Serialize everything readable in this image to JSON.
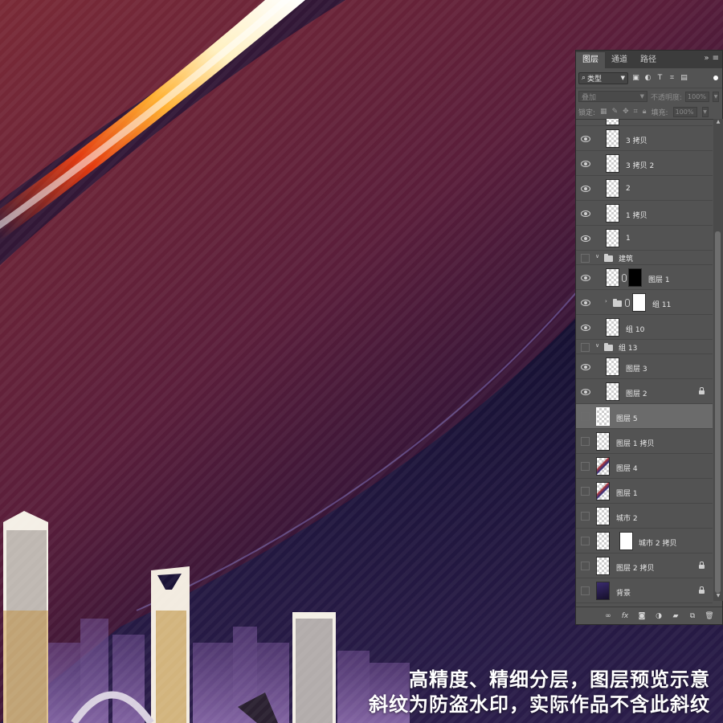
{
  "background": {
    "base_colors": [
      "#7a2a36",
      "#2a1236",
      "#0b0a26",
      "#6a4a8a"
    ],
    "streak_colors": [
      "#fff0c0",
      "#ffb030",
      "#e23a10"
    ],
    "caption_line1": "高精度、精细分层，图层预览示意",
    "caption_line2": "斜纹为防盗水印，实际作品不含此斜纹"
  },
  "panel": {
    "tabs": [
      "图层",
      "通道",
      "路径"
    ],
    "collapse_icon": "double-chevron-right-icon",
    "menu_icon": "hamburger-menu-icon",
    "filter": {
      "kind_label": "类型",
      "filter_icons": [
        "image-filter-icon",
        "adjustment-filter-icon",
        "type-filter-icon",
        "shape-filter-icon",
        "smart-object-filter-icon"
      ]
    },
    "blend_mode": "叠加",
    "opacity_label": "不透明度:",
    "opacity_value": "100%",
    "lock_label": "锁定:",
    "fill_label": "填充:",
    "fill_value": "100%",
    "layers": [
      {
        "name": "3 拷贝",
        "visible": true
      },
      {
        "name": "3 拷贝 2",
        "visible": true
      },
      {
        "name": "2",
        "visible": true
      },
      {
        "name": "1 拷贝",
        "visible": true
      },
      {
        "name": "1",
        "visible": true
      },
      {
        "name": "建筑",
        "visible": false
      },
      {
        "name": "图层 1",
        "visible": true
      },
      {
        "name": "组 11",
        "visible": true
      },
      {
        "name": "组 10",
        "visible": true
      },
      {
        "name": "组 13",
        "visible": false
      },
      {
        "name": "图层 3",
        "visible": true
      },
      {
        "name": "图层 2",
        "visible": true,
        "locked": true
      },
      {
        "name": "图层 5",
        "visible": false,
        "selected": true
      },
      {
        "name": "图层 1 拷贝",
        "visible": false
      },
      {
        "name": "图层 4",
        "visible": false
      },
      {
        "name": "图层 1",
        "visible": false
      },
      {
        "name": "城市 2",
        "visible": false
      },
      {
        "name": "城市 2 拷贝",
        "visible": false
      },
      {
        "name": "图层 2 拷贝",
        "visible": false,
        "locked": true
      },
      {
        "name": "背景",
        "visible": false,
        "locked": true
      }
    ],
    "footer_buttons": [
      "link-layers-icon",
      "fx",
      "add-mask-icon",
      "adjustment-layer-icon",
      "new-group-icon",
      "new-layer-icon",
      "delete-icon"
    ],
    "footer_fx": "fx"
  }
}
